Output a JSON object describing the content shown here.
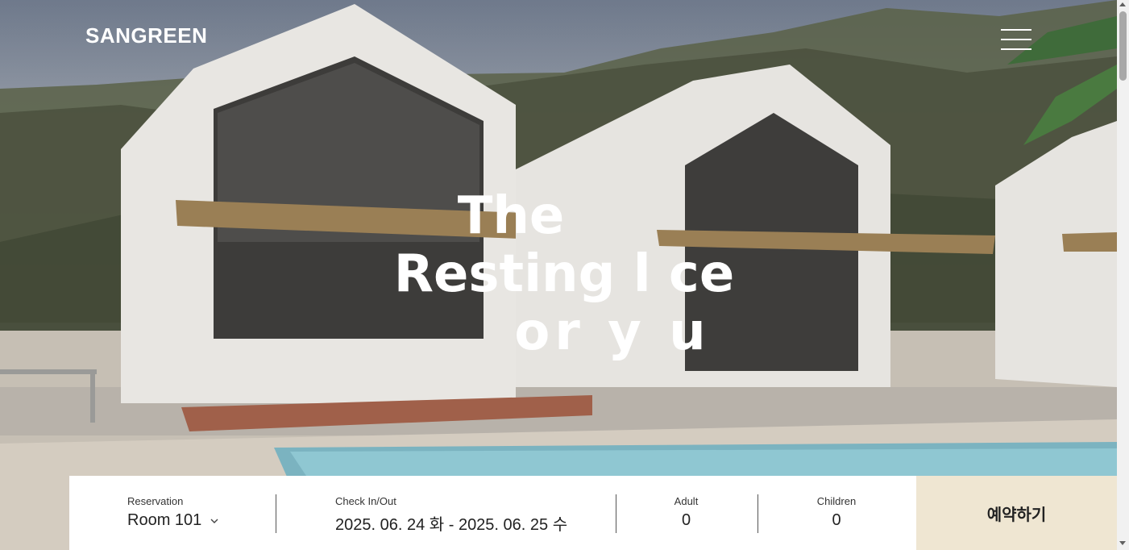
{
  "header": {
    "logo": "SANGREEN",
    "menu_icon": "hamburger-menu-icon"
  },
  "hero": {
    "line1": "The",
    "line2": "Resting  l ce",
    "line3": "or y u"
  },
  "booking": {
    "reservation_label": "Reservation",
    "reservation_value": "Room 101",
    "checkin_label": "Check In/Out",
    "checkin_value": "2025. 06. 24 화 - 2025. 06. 25 수",
    "adult_label": "Adult",
    "adult_value": "0",
    "children_label": "Children",
    "children_value": "0",
    "reserve_button": "예약하기"
  },
  "colors": {
    "reserve_bg": "#efe6d2",
    "text_white": "#ffffff",
    "text_dark": "#222222"
  }
}
